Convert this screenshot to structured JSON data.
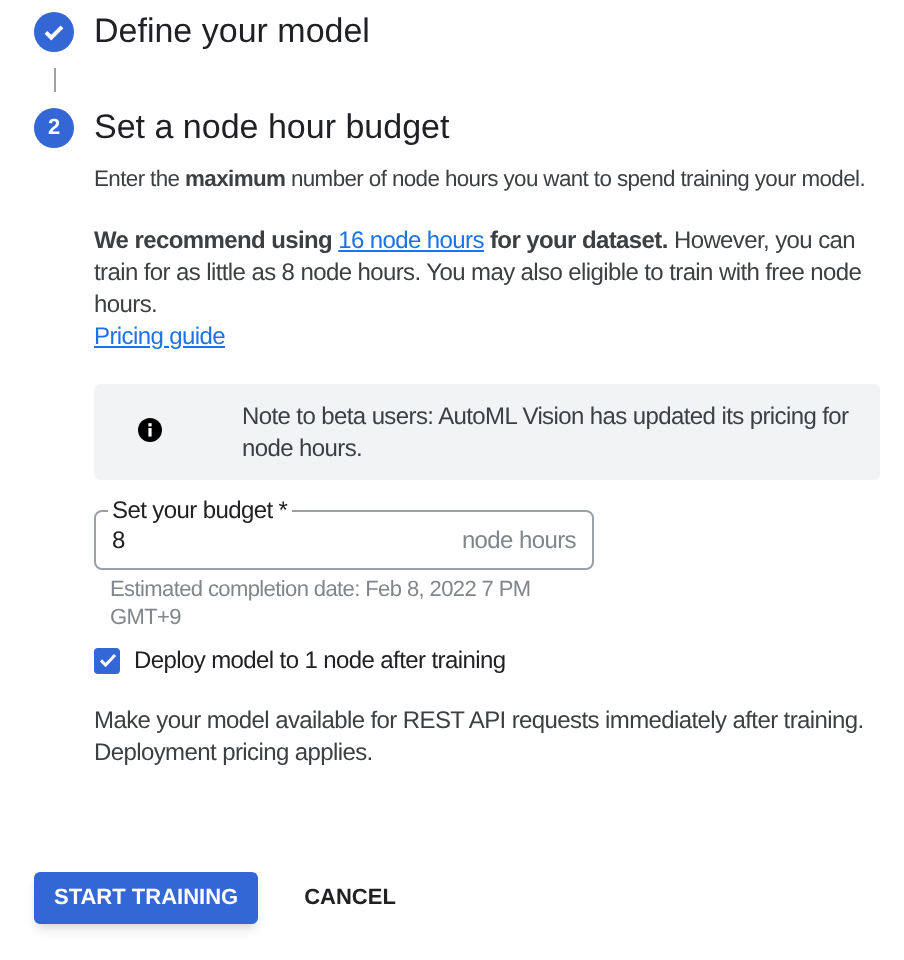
{
  "steps": [
    {
      "title": "Define your model",
      "completed": true
    },
    {
      "number": "2",
      "title": "Set a node hour budget",
      "completed": false
    }
  ],
  "intro": "Enter the **maximum** number of node hours you want to spend training your model.",
  "recommendation": {
    "before": "We recommend using",
    "link": "16 node hours",
    "after": "for your dataset.",
    "rest": "However, you can train for as little as 8 node hours. You may also eligible to train with free node hours."
  },
  "pricing_link": "Pricing guide",
  "notice": "Note to beta users: AutoML Vision has updated its pricing for node hours.",
  "budget_field": {
    "label": "Set your budget *",
    "value": "8",
    "suffix": "node hours"
  },
  "helper": "Estimated completion date: Feb 8, 2022 7 PM GMT+9",
  "deploy": {
    "label": "Deploy model to 1 node after training",
    "checked": true
  },
  "deploy_note": "Make your model available for REST API requests immediately after training. Deployment pricing applies.",
  "buttons": [
    {
      "label": "START TRAINING",
      "kind": "primary"
    },
    {
      "label": "CANCEL",
      "kind": "text"
    }
  ]
}
